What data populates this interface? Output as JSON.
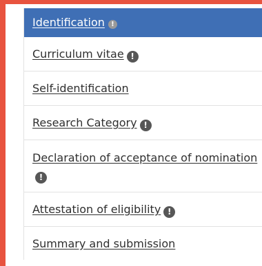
{
  "menu": {
    "items": [
      {
        "label": "Identification",
        "alert_icon": "exclamation-circle-icon",
        "active": true
      },
      {
        "label": "Curriculum vitae",
        "alert_icon": "exclamation-circle-icon"
      },
      {
        "label": "Self-identification"
      },
      {
        "label": "Research Category",
        "alert_icon": "exclamation-circle-icon"
      },
      {
        "label": "Declaration of acceptance of nomination",
        "alert_icon": "exclamation-circle-icon"
      },
      {
        "label": "Attestation of eligibility",
        "alert_icon": "exclamation-circle-icon"
      },
      {
        "label": "Summary and submission"
      }
    ],
    "alert_glyph": "!"
  },
  "colors": {
    "accent_border": "#e8533f",
    "active_background": "#3f6fb5",
    "alert_icon": "#575757"
  }
}
